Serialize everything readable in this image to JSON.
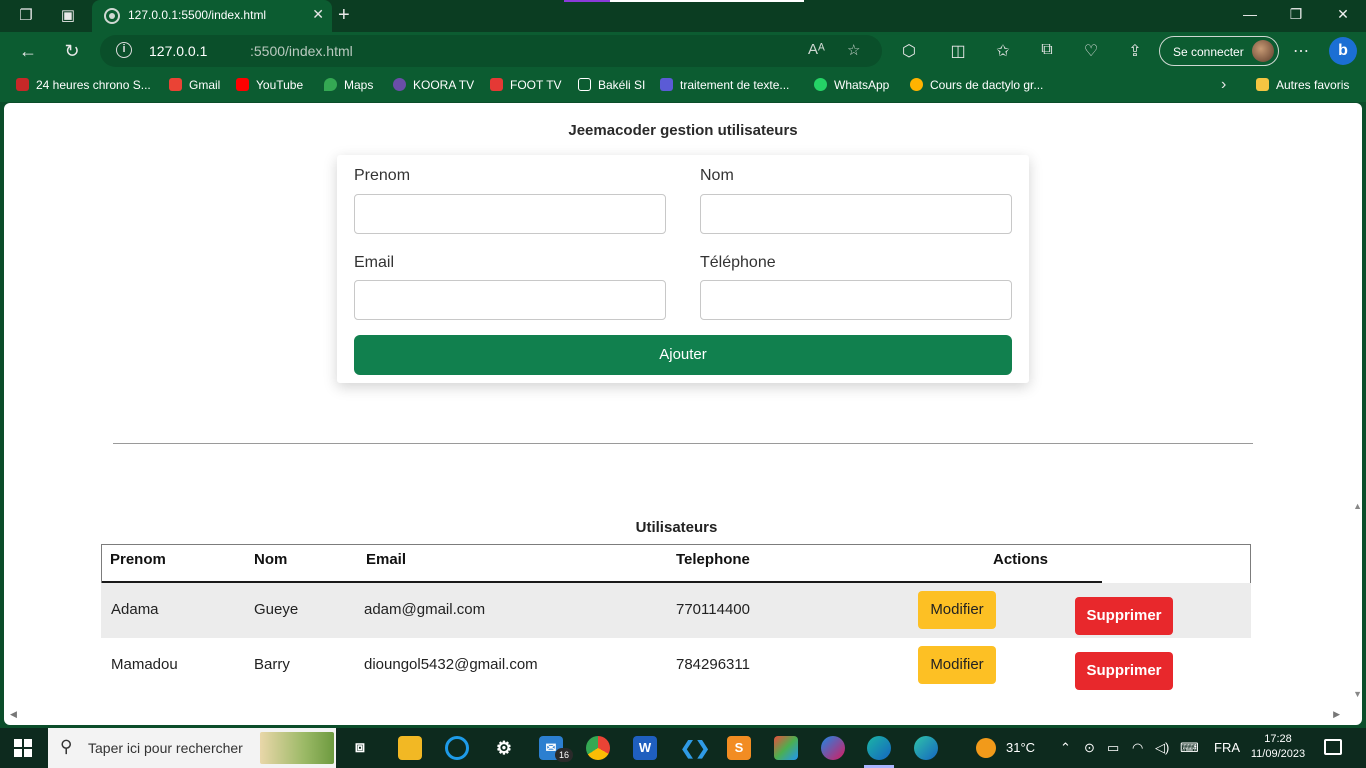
{
  "browser": {
    "tab_title": "127.0.0.1:5500/index.html",
    "tab_close": "✕",
    "new_tab": "+",
    "url_host": "127.0.0.1",
    "url_path": ":5500/index.html",
    "signin_label": "Se connecter",
    "bing_label": "b",
    "bookmarks": [
      {
        "label": "24 heures chrono S...",
        "icon": "bookmark-icon",
        "color": "#c62828"
      },
      {
        "label": "Gmail",
        "icon": "gmail-icon",
        "color": "#ea4335"
      },
      {
        "label": "YouTube",
        "icon": "youtube-icon",
        "color": "#ff0000"
      },
      {
        "label": "Maps",
        "icon": "maps-icon",
        "color": "#34a853"
      },
      {
        "label": "KOORA TV",
        "icon": "koora-icon",
        "color": "#6a4ea8"
      },
      {
        "label": "FOOT TV",
        "icon": "foot-tv-icon",
        "color": "#e53935"
      },
      {
        "label": "Bakéli SI",
        "icon": "page-icon",
        "color": "#ffffff"
      },
      {
        "label": "traitement de texte...",
        "icon": "doc-icon",
        "color": "#5b5bd6"
      },
      {
        "label": "WhatsApp",
        "icon": "whatsapp-icon",
        "color": "#25d366"
      },
      {
        "label": "Cours de dactylo gr...",
        "icon": "dactylo-icon",
        "color": "#ffb300"
      }
    ],
    "other_favorites": "Autres favoris"
  },
  "page": {
    "title": "Jeemacoder gestion utilisateurs",
    "form": {
      "prenom_label": "Prenom",
      "nom_label": "Nom",
      "email_label": "Email",
      "telephone_label": "Téléphone",
      "submit_label": "Ajouter",
      "prenom_value": "",
      "nom_value": "",
      "email_value": "",
      "telephone_value": ""
    },
    "users_title": "Utilisateurs",
    "table": {
      "headers": [
        "Prenom",
        "Nom",
        "Email",
        "Telephone",
        "Actions"
      ],
      "rows": [
        {
          "prenom": "Adama",
          "nom": "Gueye",
          "email": "adam@gmail.com",
          "telephone": "770114400"
        },
        {
          "prenom": "Mamadou",
          "nom": "Barry",
          "email": "dioungol5432@gmail.com",
          "telephone": "784296311"
        }
      ],
      "edit_label": "Modifier",
      "delete_label": "Supprimer"
    }
  },
  "taskbar": {
    "search_placeholder": "Taper ici pour rechercher",
    "mail_badge": "16",
    "weather": "31°C",
    "language": "FRA",
    "time": "17:28",
    "date": "11/09/2023"
  },
  "colors": {
    "browser_frame": "#0c5c31",
    "add_button": "#11804e",
    "edit_button": "#fdc024",
    "delete_button": "#e8282c"
  }
}
